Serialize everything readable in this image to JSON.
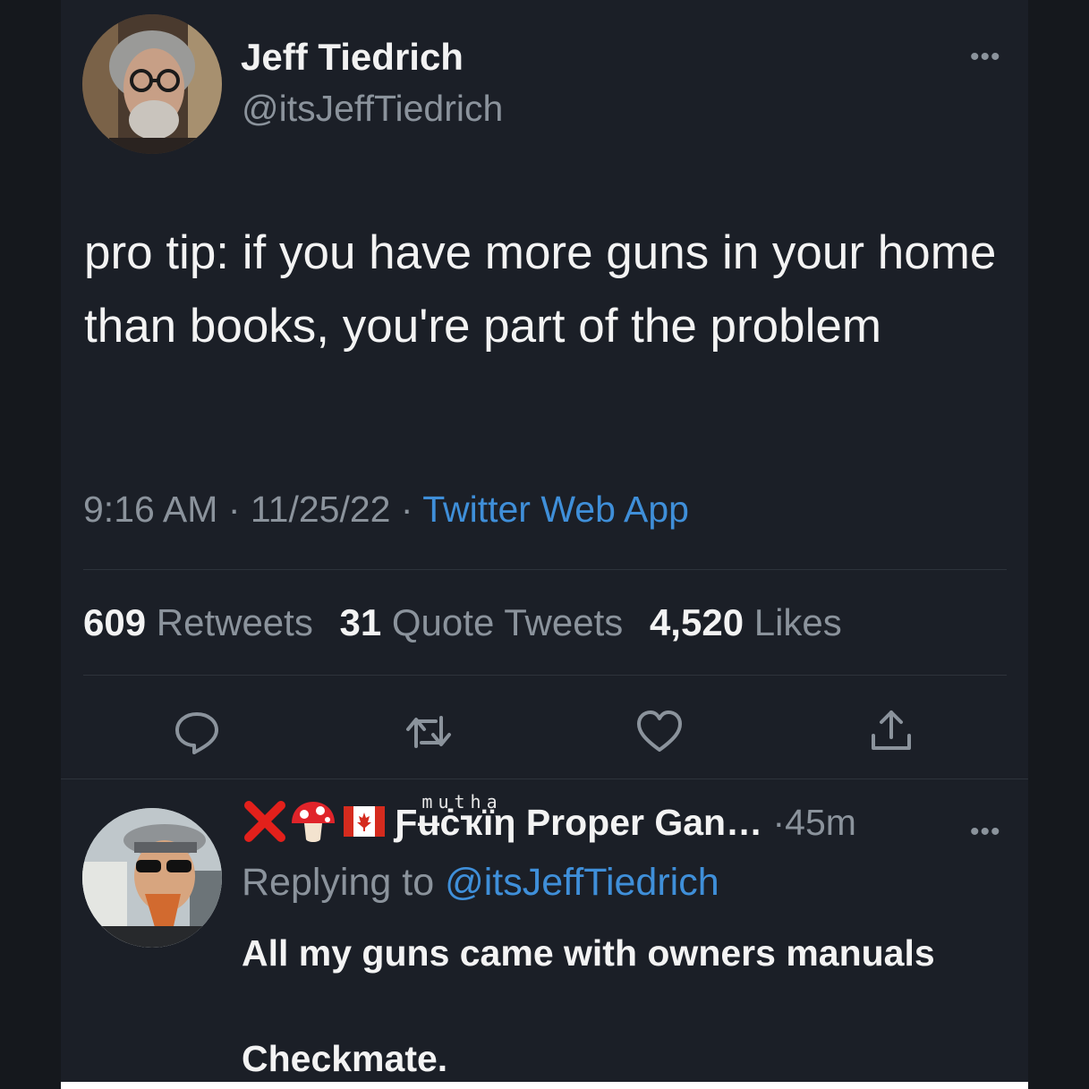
{
  "tweet": {
    "author": {
      "name": "Jeff Tiedrich",
      "handle": "@itsJeffTiedrich",
      "avatar_icon": "profile-photo-icon"
    },
    "more_label": "•••",
    "text": "pro tip: if you have more guns in your home than books, you're part of the problem",
    "time": "9:16 AM",
    "date": "11/25/22",
    "separator": "·",
    "source": "Twitter Web App",
    "stats": {
      "retweets_count": "609",
      "retweets_label": "Retweets",
      "quotes_count": "31",
      "quotes_label": "Quote Tweets",
      "likes_count": "4,520",
      "likes_label": "Likes"
    },
    "actions": [
      {
        "name": "reply-icon"
      },
      {
        "name": "retweet-icon"
      },
      {
        "name": "like-icon"
      },
      {
        "name": "share-icon"
      }
    ]
  },
  "reply": {
    "author": {
      "emoji": [
        "cross-mark-icon",
        "mushroom-icon",
        "canada-flag-icon"
      ],
      "name_fancy": "Ƒʉċҡїη",
      "name_fancy_sup": "mutha",
      "name_rest": "Proper Gan…",
      "avatar_icon": "profile-photo-icon"
    },
    "separator": "·",
    "time": "45m",
    "more_label": "•••",
    "replying_prefix": "Replying to",
    "replying_handle": "@itsJeffTiedrich",
    "text": "All my guns came with owners manuals\n\nCheckmate."
  },
  "colors": {
    "background": "#1b1f27",
    "text_primary": "#f3f3f3",
    "text_secondary": "#8b939c",
    "link": "#3f8fd9",
    "divider": "#2d333b"
  }
}
